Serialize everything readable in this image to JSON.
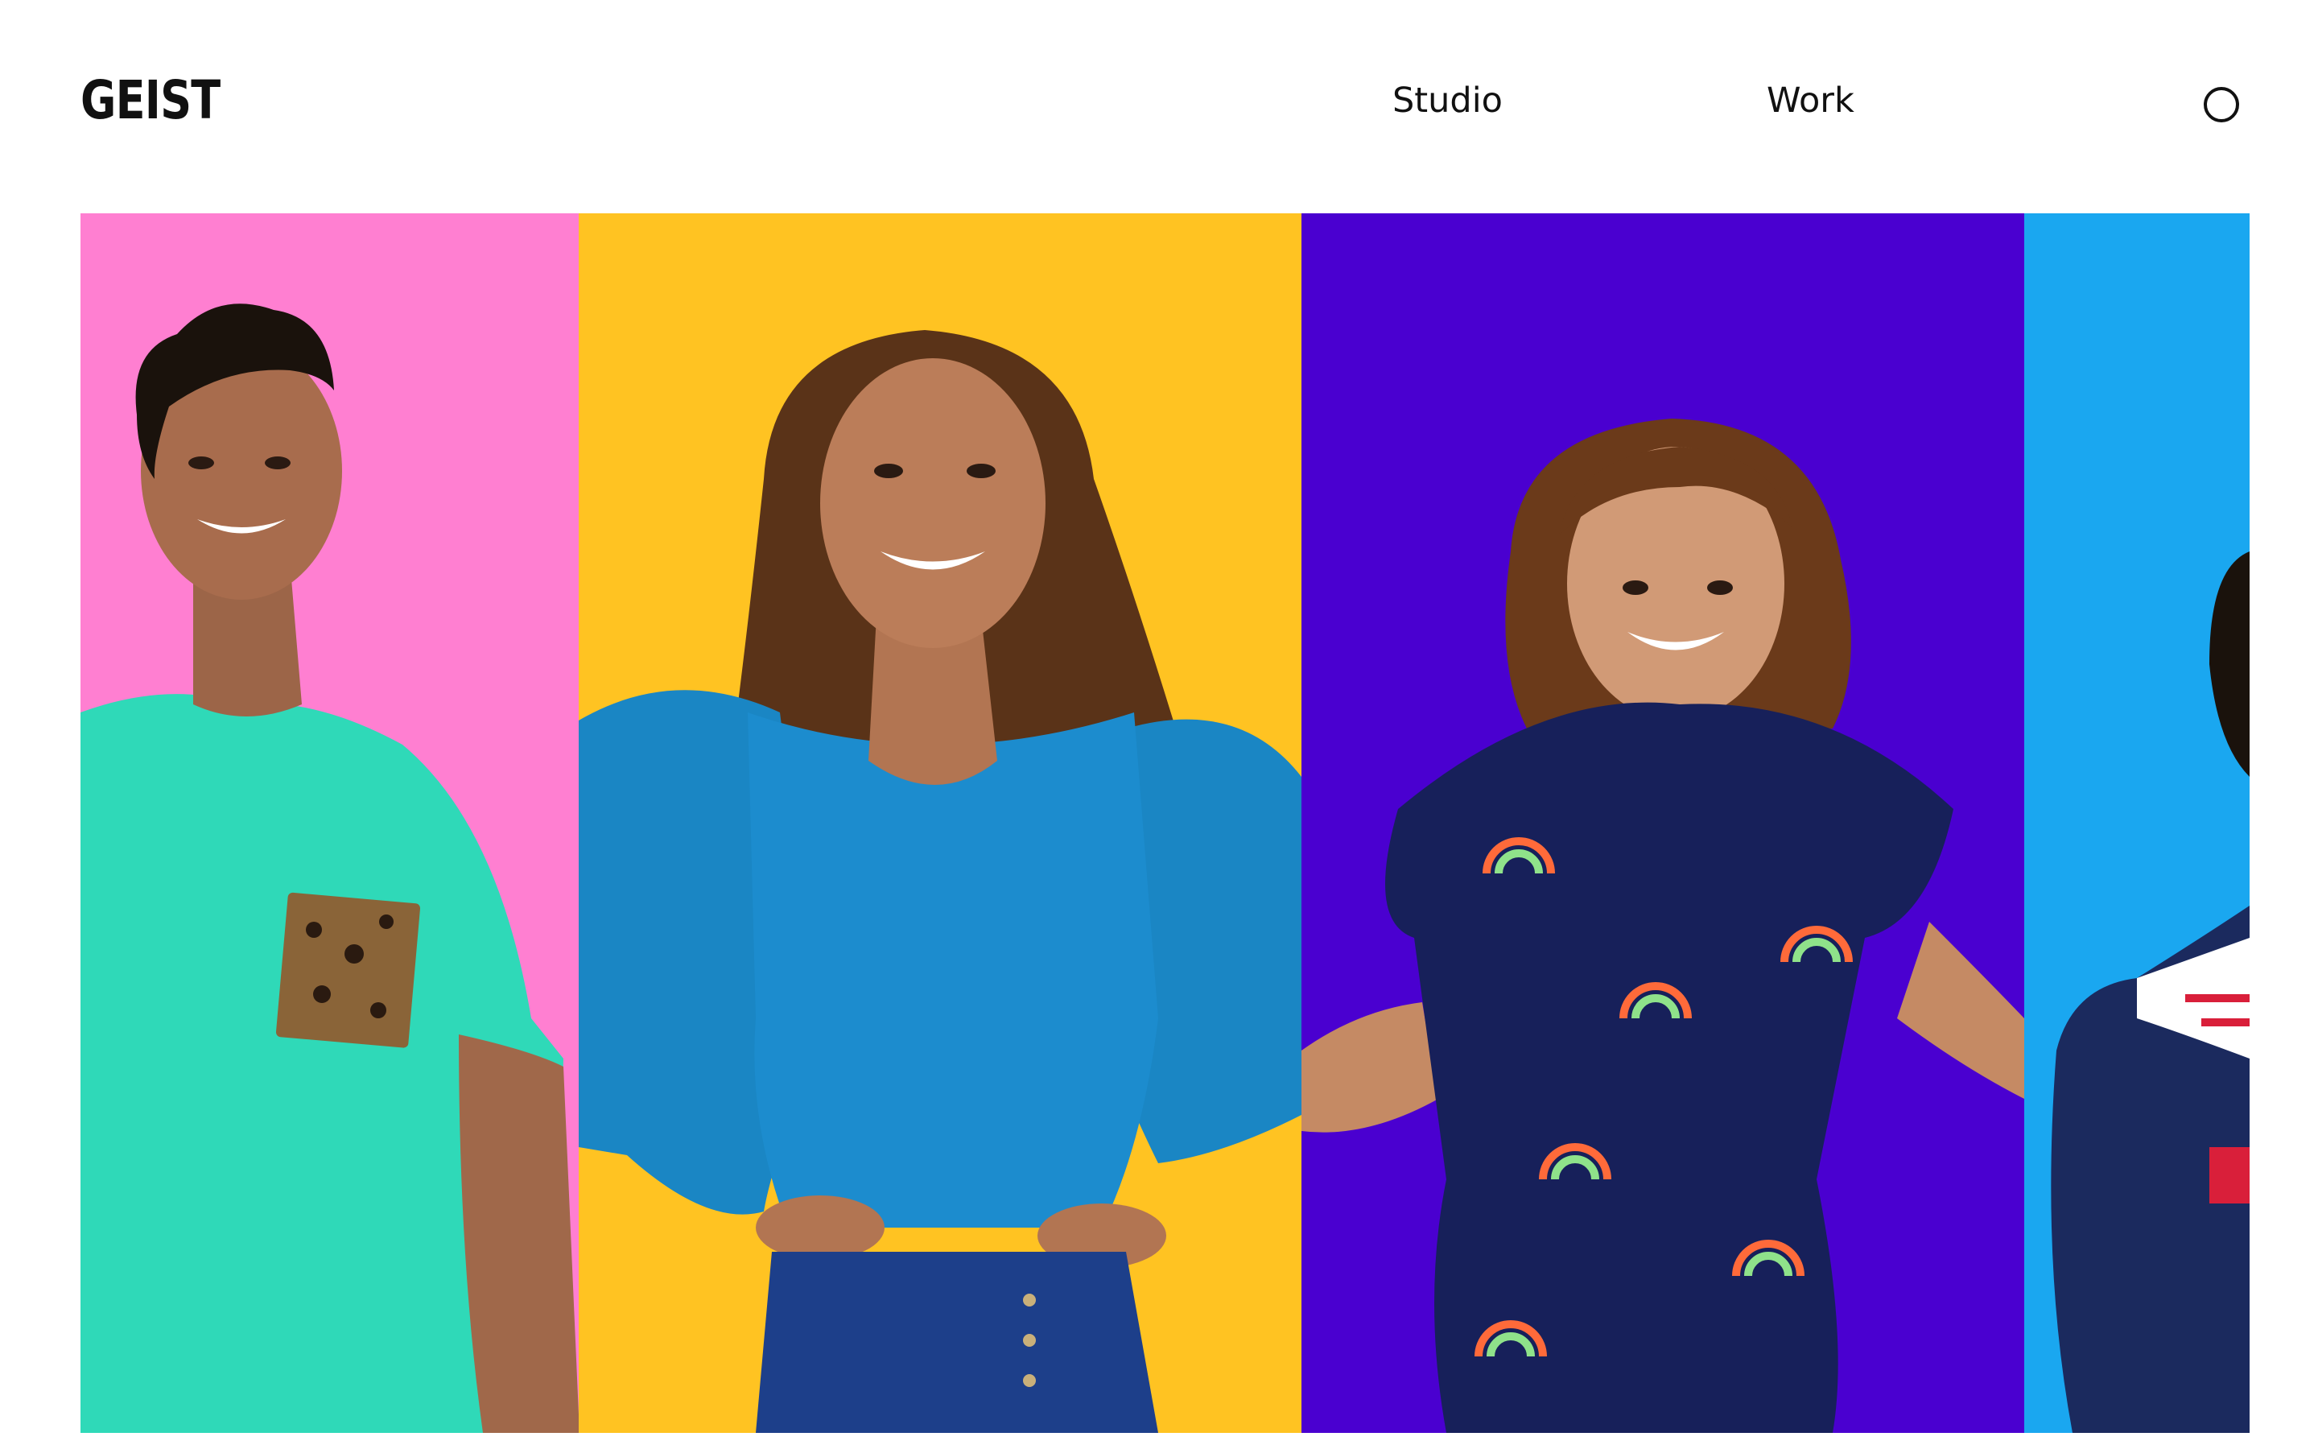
{
  "header": {
    "logo": "GEIST",
    "nav": [
      {
        "label": "Studio"
      },
      {
        "label": "Work"
      }
    ],
    "menu_icon": "circle-menu-icon"
  },
  "gallery": {
    "panels": [
      {
        "background": "#ff7fd1",
        "shirt": "#2fd9b8",
        "accent": "leopard-pocket"
      },
      {
        "background": "#ffc322",
        "shirt": "#1a86c4",
        "accent": "denim"
      },
      {
        "background": "#4a00d0",
        "shirt": "#17205a",
        "accent": "rainbow-print"
      },
      {
        "background": "#1aa7f0",
        "shirt": "#1b2a5e",
        "accent": "striped-shoulder"
      }
    ]
  },
  "colors": {
    "text": "#111111",
    "background": "#ffffff"
  }
}
